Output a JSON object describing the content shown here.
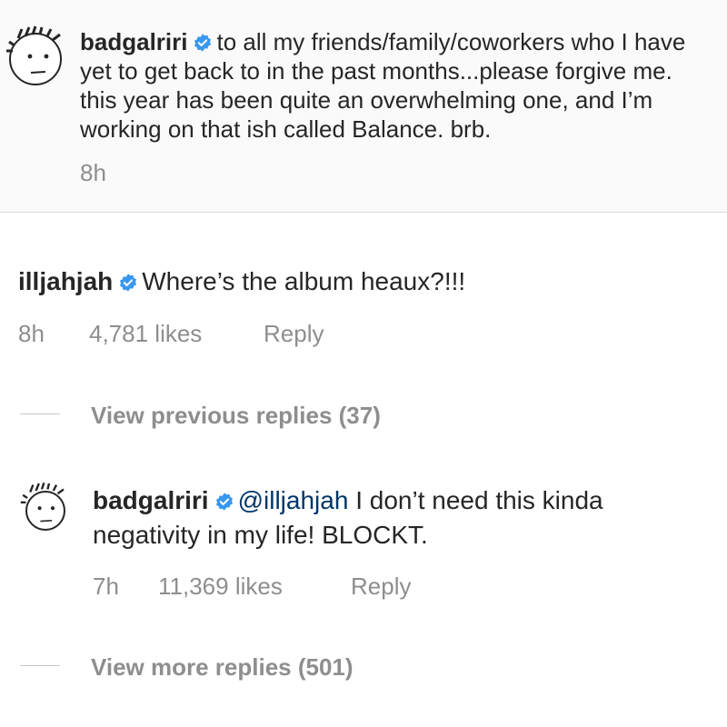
{
  "caption": {
    "username": "badgalriri",
    "text": "to all my friends/family/coworkers who I have yet to get back to in the past months...please forgive me. this year has been quite an overwhelming one, and I’m working on that ish called Balance. brb.",
    "time": "8h"
  },
  "comment": {
    "username": "illjahjah",
    "text": "Where’s the album heaux?!!!",
    "time": "8h",
    "likes": "4,781 likes",
    "reply_label": "Reply",
    "view_replies": "View previous replies (37)"
  },
  "reply": {
    "username": "badgalriri",
    "mention": "@illjahjah",
    "text": " I don’t need this kinda negativity in my life! BLOCKT.",
    "time": "7h",
    "likes": "11,369 likes",
    "reply_label": "Reply",
    "view_replies": "View more replies (501)"
  },
  "colors": {
    "verified_badge": "#3897f0",
    "mention": "#003569",
    "meta_text": "#8e8e8e"
  },
  "icons": {
    "verified": "verified-badge-icon",
    "avatar": "doodle-face-avatar"
  }
}
